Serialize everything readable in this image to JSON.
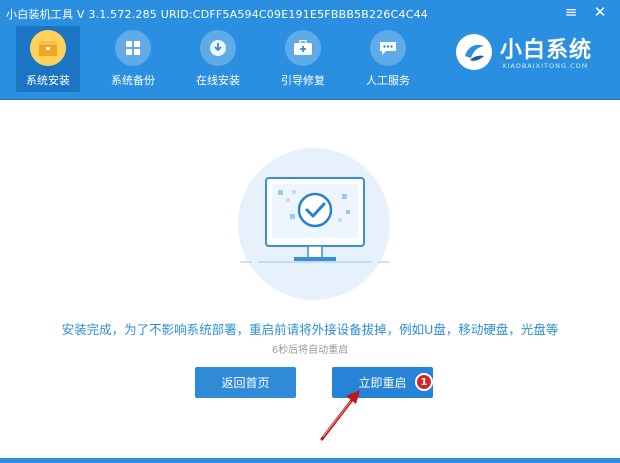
{
  "window": {
    "title": "小白装机工具 V 3.1.572.285 URID:CDFF5A594C09E191E5FBBB5B226C4C44",
    "menu_icon": "menu-icon",
    "close_icon": "close-icon"
  },
  "nav": {
    "items": [
      {
        "label": "系统安装",
        "icon": "box-icon",
        "active": true
      },
      {
        "label": "系统备份",
        "icon": "windows-icon",
        "active": false
      },
      {
        "label": "在线安装",
        "icon": "download-icon",
        "active": false
      },
      {
        "label": "引导修复",
        "icon": "medkit-icon",
        "active": false
      },
      {
        "label": "人工服务",
        "icon": "chat-icon",
        "active": false
      }
    ]
  },
  "brand": {
    "name": "小白系统",
    "subtitle": "XIAOBAIXITONG.COM"
  },
  "main": {
    "message": "安装完成，为了不影响系统部署，重启前请将外接设备拔掉，例如U盘，移动硬盘，光盘等",
    "countdown": "6秒后将自动重启",
    "home_button": "返回首页",
    "restart_button": "立即重启",
    "badge": "1"
  },
  "colors": {
    "primary": "#2a8fe0",
    "accent": "#ffd25c",
    "message": "#2c8fd8",
    "badge": "#d42424"
  }
}
